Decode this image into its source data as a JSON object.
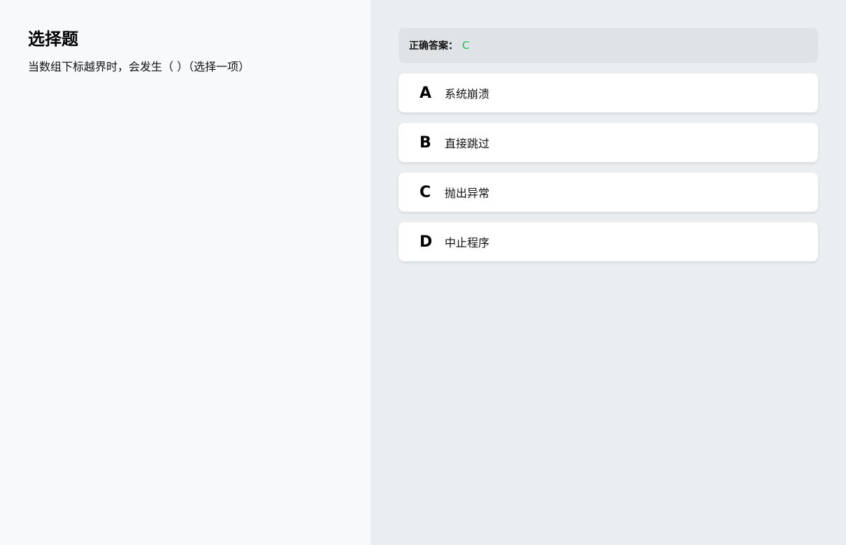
{
  "question": {
    "type_title": "选择题",
    "text": "当数组下标越界时，会发生（ ）（选择一项）"
  },
  "answer": {
    "label": "正确答案：",
    "value": "C",
    "value_color": "#22bb55"
  },
  "options": [
    {
      "letter": "A",
      "text": "系统崩溃"
    },
    {
      "letter": "B",
      "text": "直接跳过"
    },
    {
      "letter": "C",
      "text": "抛出异常"
    },
    {
      "letter": "D",
      "text": "中止程序"
    }
  ]
}
